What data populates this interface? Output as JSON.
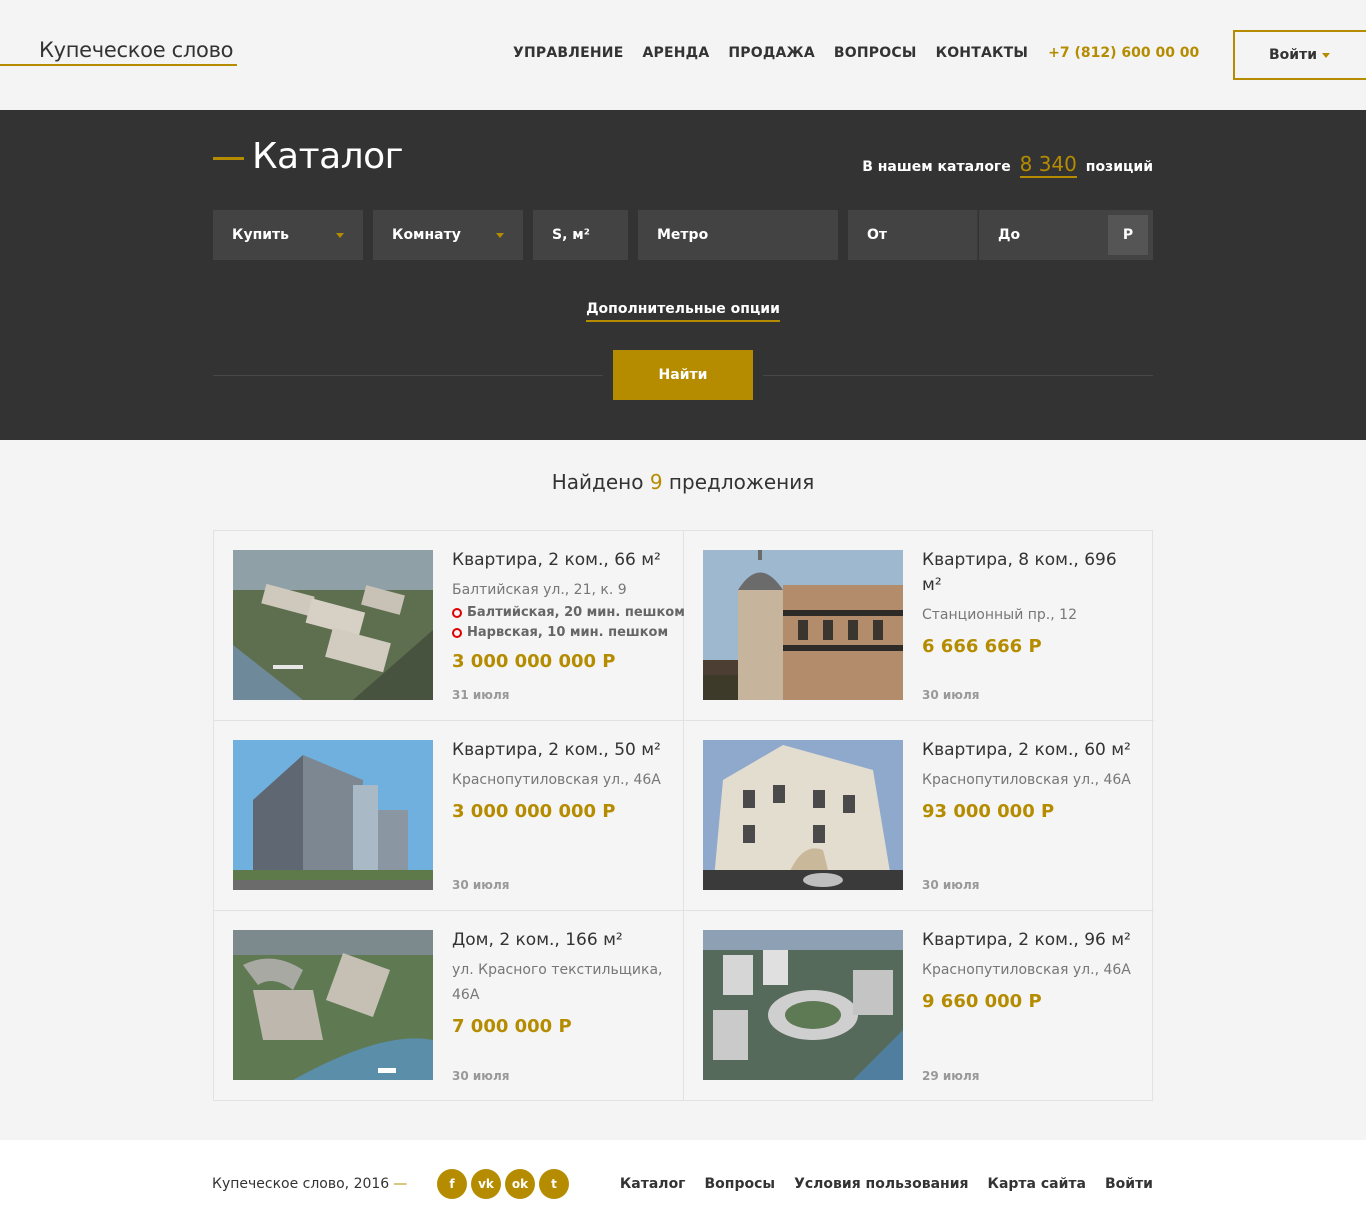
{
  "header": {
    "logo": "Купеческое слово",
    "nav": [
      "УПРАВЛЕНИЕ",
      "АРЕНДА",
      "ПРОДАЖА",
      "ВОПРОСЫ",
      "КОНТАКТЫ"
    ],
    "phone": "+7 (812) 600 00 00",
    "login_label": "Войти"
  },
  "catalog": {
    "title": "Каталог",
    "count_prefix": "В нашем каталоге",
    "count_value": "8 340",
    "count_suffix": "позиций",
    "filters": {
      "deal": "Купить",
      "rooms": "Комнату",
      "area": "S, м²",
      "metro": "Метро",
      "price_from": "От",
      "price_to": "До",
      "currency": "Р"
    },
    "more_options": "Дополнительные опции",
    "search_label": "Найти"
  },
  "results": {
    "found_prefix": "Найдено",
    "found_count": "9",
    "found_suffix": "предложения",
    "items": [
      {
        "title": "Квартира, 2 ком., 66 м²",
        "address": "Балтийская ул., 21, к. 9",
        "metro": [
          "Балтийская, 20 мин. пешком",
          "Нарвская, 10 мин. пешком"
        ],
        "price": "3 000 000 000 Р",
        "date": "31 июля"
      },
      {
        "title": "Квартира, 8 ком., 696 м²",
        "address": "Станционный пр., 12",
        "metro": [],
        "price": "6 666 666 Р",
        "date": "30 июля"
      },
      {
        "title": "Квартира, 2 ком., 50 м²",
        "address": "Краснопутиловская ул., 46А",
        "metro": [],
        "price": "3 000 000 000 Р",
        "date": "30 июля"
      },
      {
        "title": "Квартира, 2 ком., 60 м²",
        "address": "Краснопутиловская ул., 46А",
        "metro": [],
        "price": "93 000 000 Р",
        "date": "30 июля"
      },
      {
        "title": "Дом, 2 ком., 166 м²",
        "address": "ул. Красного текстильщика, 46А",
        "metro": [],
        "price": "7 000 000 Р",
        "date": "30 июля"
      },
      {
        "title": "Квартира, 2 ком., 96 м²",
        "address": "Краснопутиловская ул., 46А",
        "metro": [],
        "price": "9 660 000 Р",
        "date": "29 июля"
      }
    ]
  },
  "footer": {
    "copyright": "Купеческое слово, 2016",
    "dash": "—",
    "socials": [
      "facebook-icon",
      "vk-icon",
      "odnoklassniki-icon",
      "twitter-icon"
    ],
    "links": [
      "Каталог",
      "Вопросы",
      "Условия пользования",
      "Карта сайта",
      "Войти"
    ]
  },
  "colors": {
    "accent": "#b58c00",
    "dark_panel": "#333333",
    "field": "#434343",
    "background": "#f4f4f4",
    "metro_red": "#e00000"
  }
}
